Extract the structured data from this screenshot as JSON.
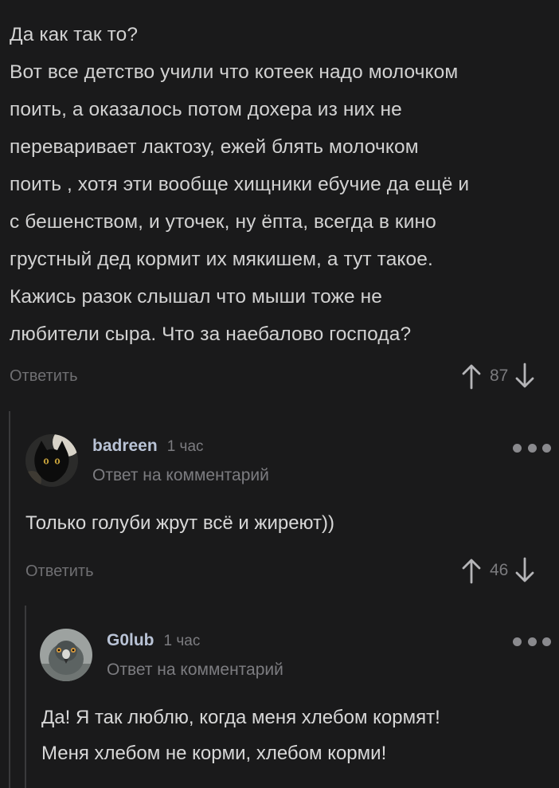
{
  "main_comment": {
    "lines": [
      "Да как так то?",
      "Вот все детство учили что котеек надо молочком",
      "поить, а оказалось потом дохера из них не",
      "переваривает лактозу, ежей блять молочком",
      "поить , хотя эти вообще хищники ебучие да ещё и",
      "с бешенством, и уточек, ну ёпта, всегда в кино",
      "грустный дед кормит их мякишем, а тут такое.",
      "Кажись разок слышал что мыши тоже не",
      "любители сыра. Что за наебалово господа?"
    ],
    "reply_label": "Ответить",
    "score": "87"
  },
  "reply_1": {
    "author": "badreen",
    "time": "1 час",
    "reply_to": "Ответ на комментарий",
    "lines": [
      "Только голуби жрут всё и жиреют))"
    ],
    "reply_label": "Ответить",
    "score": "46",
    "avatar_icon": "black-cat-avatar"
  },
  "reply_2": {
    "author": "G0lub",
    "time": "1 час",
    "reply_to": "Ответ на комментарий",
    "lines": [
      "Да! Я так люблю, когда меня хлебом кормят!",
      "Меня хлебом не корми, хлебом корми!"
    ],
    "avatar_icon": "pigeon-avatar"
  },
  "colors": {
    "background": "#1a1a1b",
    "text": "#d2d2d2",
    "muted": "#7c7c80",
    "author": "#b9c3d6"
  }
}
